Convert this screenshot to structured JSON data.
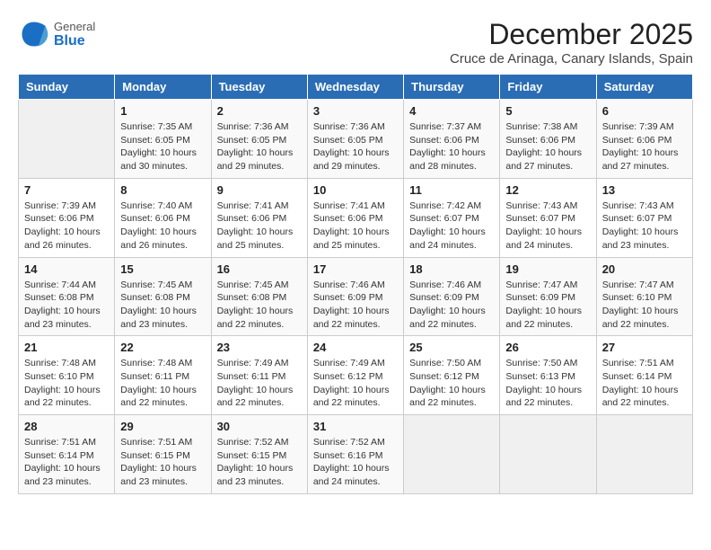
{
  "logo": {
    "general": "General",
    "blue": "Blue"
  },
  "title": "December 2025",
  "location": "Cruce de Arinaga, Canary Islands, Spain",
  "days_of_week": [
    "Sunday",
    "Monday",
    "Tuesday",
    "Wednesday",
    "Thursday",
    "Friday",
    "Saturday"
  ],
  "weeks": [
    [
      {
        "day": "",
        "info": ""
      },
      {
        "day": "1",
        "info": "Sunrise: 7:35 AM\nSunset: 6:05 PM\nDaylight: 10 hours\nand 30 minutes."
      },
      {
        "day": "2",
        "info": "Sunrise: 7:36 AM\nSunset: 6:05 PM\nDaylight: 10 hours\nand 29 minutes."
      },
      {
        "day": "3",
        "info": "Sunrise: 7:36 AM\nSunset: 6:05 PM\nDaylight: 10 hours\nand 29 minutes."
      },
      {
        "day": "4",
        "info": "Sunrise: 7:37 AM\nSunset: 6:06 PM\nDaylight: 10 hours\nand 28 minutes."
      },
      {
        "day": "5",
        "info": "Sunrise: 7:38 AM\nSunset: 6:06 PM\nDaylight: 10 hours\nand 27 minutes."
      },
      {
        "day": "6",
        "info": "Sunrise: 7:39 AM\nSunset: 6:06 PM\nDaylight: 10 hours\nand 27 minutes."
      }
    ],
    [
      {
        "day": "7",
        "info": "Sunrise: 7:39 AM\nSunset: 6:06 PM\nDaylight: 10 hours\nand 26 minutes."
      },
      {
        "day": "8",
        "info": "Sunrise: 7:40 AM\nSunset: 6:06 PM\nDaylight: 10 hours\nand 26 minutes."
      },
      {
        "day": "9",
        "info": "Sunrise: 7:41 AM\nSunset: 6:06 PM\nDaylight: 10 hours\nand 25 minutes."
      },
      {
        "day": "10",
        "info": "Sunrise: 7:41 AM\nSunset: 6:06 PM\nDaylight: 10 hours\nand 25 minutes."
      },
      {
        "day": "11",
        "info": "Sunrise: 7:42 AM\nSunset: 6:07 PM\nDaylight: 10 hours\nand 24 minutes."
      },
      {
        "day": "12",
        "info": "Sunrise: 7:43 AM\nSunset: 6:07 PM\nDaylight: 10 hours\nand 24 minutes."
      },
      {
        "day": "13",
        "info": "Sunrise: 7:43 AM\nSunset: 6:07 PM\nDaylight: 10 hours\nand 23 minutes."
      }
    ],
    [
      {
        "day": "14",
        "info": "Sunrise: 7:44 AM\nSunset: 6:08 PM\nDaylight: 10 hours\nand 23 minutes."
      },
      {
        "day": "15",
        "info": "Sunrise: 7:45 AM\nSunset: 6:08 PM\nDaylight: 10 hours\nand 23 minutes."
      },
      {
        "day": "16",
        "info": "Sunrise: 7:45 AM\nSunset: 6:08 PM\nDaylight: 10 hours\nand 22 minutes."
      },
      {
        "day": "17",
        "info": "Sunrise: 7:46 AM\nSunset: 6:09 PM\nDaylight: 10 hours\nand 22 minutes."
      },
      {
        "day": "18",
        "info": "Sunrise: 7:46 AM\nSunset: 6:09 PM\nDaylight: 10 hours\nand 22 minutes."
      },
      {
        "day": "19",
        "info": "Sunrise: 7:47 AM\nSunset: 6:09 PM\nDaylight: 10 hours\nand 22 minutes."
      },
      {
        "day": "20",
        "info": "Sunrise: 7:47 AM\nSunset: 6:10 PM\nDaylight: 10 hours\nand 22 minutes."
      }
    ],
    [
      {
        "day": "21",
        "info": "Sunrise: 7:48 AM\nSunset: 6:10 PM\nDaylight: 10 hours\nand 22 minutes."
      },
      {
        "day": "22",
        "info": "Sunrise: 7:48 AM\nSunset: 6:11 PM\nDaylight: 10 hours\nand 22 minutes."
      },
      {
        "day": "23",
        "info": "Sunrise: 7:49 AM\nSunset: 6:11 PM\nDaylight: 10 hours\nand 22 minutes."
      },
      {
        "day": "24",
        "info": "Sunrise: 7:49 AM\nSunset: 6:12 PM\nDaylight: 10 hours\nand 22 minutes."
      },
      {
        "day": "25",
        "info": "Sunrise: 7:50 AM\nSunset: 6:12 PM\nDaylight: 10 hours\nand 22 minutes."
      },
      {
        "day": "26",
        "info": "Sunrise: 7:50 AM\nSunset: 6:13 PM\nDaylight: 10 hours\nand 22 minutes."
      },
      {
        "day": "27",
        "info": "Sunrise: 7:51 AM\nSunset: 6:14 PM\nDaylight: 10 hours\nand 22 minutes."
      }
    ],
    [
      {
        "day": "28",
        "info": "Sunrise: 7:51 AM\nSunset: 6:14 PM\nDaylight: 10 hours\nand 23 minutes."
      },
      {
        "day": "29",
        "info": "Sunrise: 7:51 AM\nSunset: 6:15 PM\nDaylight: 10 hours\nand 23 minutes."
      },
      {
        "day": "30",
        "info": "Sunrise: 7:52 AM\nSunset: 6:15 PM\nDaylight: 10 hours\nand 23 minutes."
      },
      {
        "day": "31",
        "info": "Sunrise: 7:52 AM\nSunset: 6:16 PM\nDaylight: 10 hours\nand 24 minutes."
      },
      {
        "day": "",
        "info": ""
      },
      {
        "day": "",
        "info": ""
      },
      {
        "day": "",
        "info": ""
      }
    ]
  ]
}
